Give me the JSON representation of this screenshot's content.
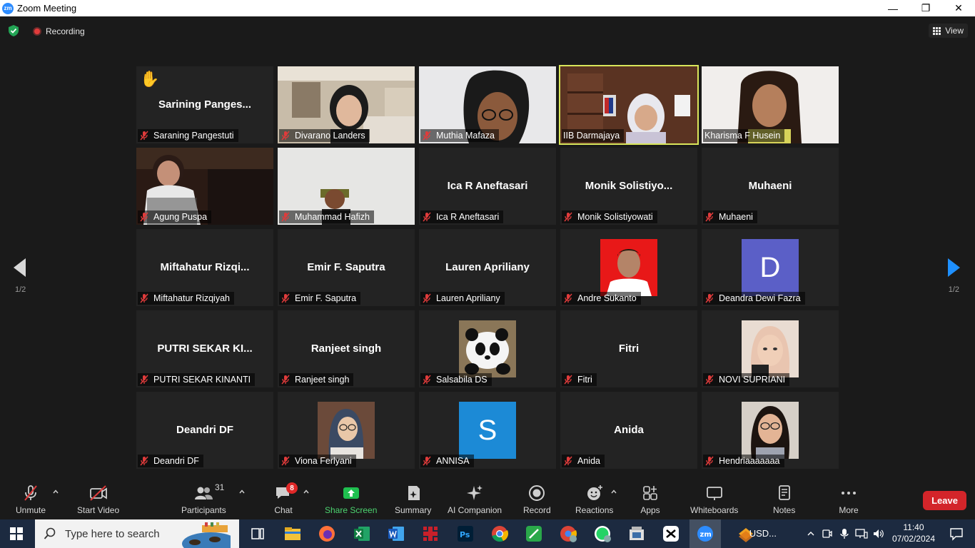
{
  "window": {
    "title": "Zoom Meeting",
    "minimize": "—",
    "restore": "❐",
    "close": "✕"
  },
  "topbar": {
    "recording_label": "Recording",
    "view_label": "View"
  },
  "pagination": {
    "left": "1/2",
    "right": "1/2"
  },
  "participants": [
    {
      "display": "Sarining  Panges...",
      "name": "Saraning Pangestuti",
      "hand": "✋"
    },
    {
      "name": "Divarano Landers"
    },
    {
      "name": "Muthia Mafaza"
    },
    {
      "name": "IIB Darmajaya"
    },
    {
      "name": "Kharisma F Husein"
    },
    {
      "name": "Agung Puspa"
    },
    {
      "name": "Muhammad Hafizh"
    },
    {
      "display": "Ica R Aneftasari",
      "name": "Ica R Aneftasari"
    },
    {
      "display": "Monik  Solistiyo...",
      "name": "Monik Solistiyowati"
    },
    {
      "display": "Muhaeni",
      "name": "Muhaeni"
    },
    {
      "display": "Miftahatur  Rizqi...",
      "name": "Miftahatur Rizqiyah"
    },
    {
      "display": "Emir F. Saputra",
      "name": "Emir F. Saputra"
    },
    {
      "display": "Lauren Apriliany",
      "name": "Lauren Apriliany"
    },
    {
      "name": "Andre Sukanto"
    },
    {
      "letter": "D",
      "name": "Deandra Dewi Fazra",
      "color": "#5b5fc7"
    },
    {
      "display": "PUTRI SEKAR KI...",
      "name": "PUTRI SEKAR KINANTI"
    },
    {
      "display": "Ranjeet singh",
      "name": "Ranjeet singh"
    },
    {
      "name": "Salsabila DS"
    },
    {
      "display": "Fitri",
      "name": "Fitri"
    },
    {
      "name": "NOVI SUPRIANI"
    },
    {
      "display": "Deandri DF",
      "name": "Deandri DF"
    },
    {
      "name": "Viona Ferlyani"
    },
    {
      "letter": "S",
      "name": "ANNISA",
      "color": "#1c8ad6"
    },
    {
      "display": "Anida",
      "name": "Anida"
    },
    {
      "name": "Hendriaaaaaaa"
    }
  ],
  "toolbar": {
    "unmute": "Unmute",
    "start_video": "Start Video",
    "participants": "Participants",
    "participants_count": "31",
    "chat": "Chat",
    "chat_badge": "8",
    "share_screen": "Share Screen",
    "summary": "Summary",
    "ai_companion": "AI Companion",
    "record": "Record",
    "reactions": "Reactions",
    "apps": "Apps",
    "whiteboards": "Whiteboards",
    "notes": "Notes",
    "more": "More",
    "leave": "Leave"
  },
  "taskbar": {
    "search_placeholder": "Type here to search",
    "tray_label": "USD...",
    "time": "11:40",
    "date": "07/02/2024"
  },
  "colors": {
    "share_green": "#1fbf4f",
    "leave_red": "#d3252a",
    "active_speaker": "#d9e65b",
    "zoom_blue": "#2d8cff"
  }
}
